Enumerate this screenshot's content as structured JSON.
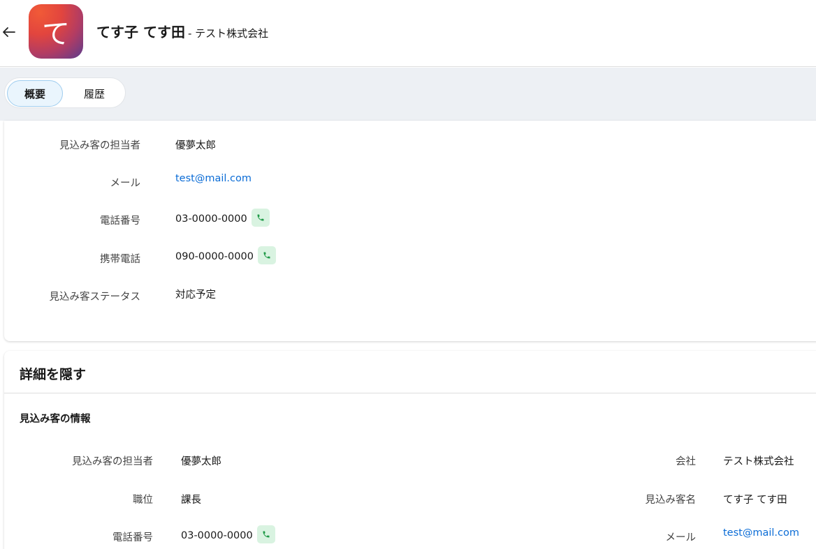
{
  "header": {
    "back_icon": "arrow-left-icon",
    "avatar_initial": "て",
    "name": "てす子 てす田",
    "company": "- テスト株式会社"
  },
  "tabs": [
    {
      "label": "概要",
      "active": true
    },
    {
      "label": "履歴",
      "active": false
    }
  ],
  "summary": {
    "fields": [
      {
        "label": "見込み客の担当者",
        "value": "優夢太郎"
      },
      {
        "label": "メール",
        "value": "test@mail.com"
      },
      {
        "label": "電話番号",
        "value": "03-0000-0000"
      },
      {
        "label": "携帯電話",
        "value": "090-0000-0000"
      },
      {
        "label": "見込み客ステータス",
        "value": "対応予定"
      }
    ]
  },
  "details": {
    "toggle_label": "詳細を隠す",
    "section_title": "見込み客の情報",
    "left_fields": [
      {
        "label": "見込み客の担当者",
        "value": "優夢太郎"
      },
      {
        "label": "職位",
        "value": "課長"
      },
      {
        "label": "電話番号",
        "value": "03-0000-0000"
      }
    ],
    "right_fields": [
      {
        "label": "会社",
        "value": "テスト株式会社"
      },
      {
        "label": "見込み客名",
        "value": "てす子 てす田"
      },
      {
        "label": "メール",
        "value": "test@mail.com"
      }
    ]
  },
  "colors": {
    "link": "#0b6cd6",
    "call_button_bg": "#d9f3e1",
    "call_icon": "#1f9a47",
    "tab_band": "#edf0f4"
  }
}
